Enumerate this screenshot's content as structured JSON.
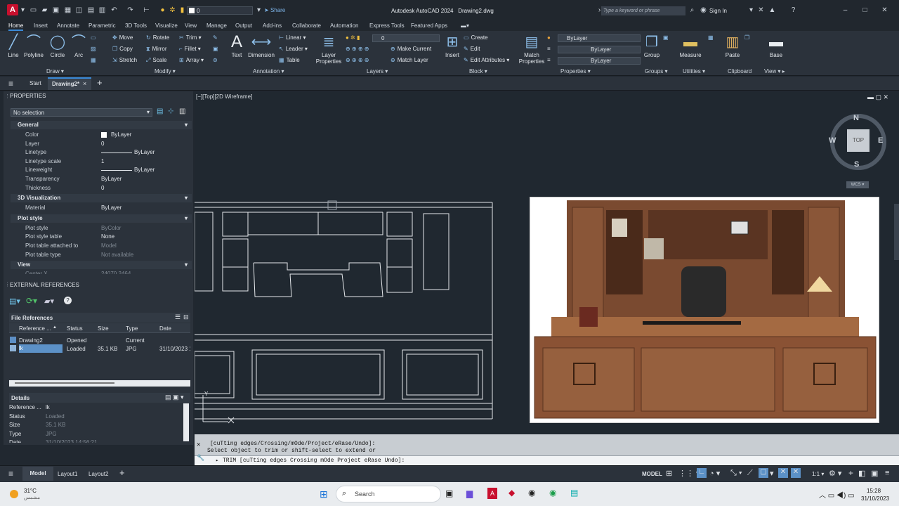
{
  "title": {
    "app_logo": "A",
    "workspace": "0",
    "share": "Share",
    "app_name": "Autodesk AutoCAD 2024",
    "document": "Drawing2.dwg",
    "search_placeholder": "Type a keyword or phrase",
    "sign_in": "Sign In"
  },
  "ribbon_tabs": [
    "Home",
    "Insert",
    "Annotate",
    "Parametric",
    "3D Tools",
    "Visualize",
    "View",
    "Manage",
    "Output",
    "Add-ins",
    "Collaborate",
    "Automation",
    "Express Tools",
    "Featured Apps"
  ],
  "ribbon": {
    "draw": {
      "line": "Line",
      "polyline": "Polyline",
      "circle": "Circle",
      "arc": "Arc",
      "label": "Draw"
    },
    "modify": {
      "move": "Move",
      "rotate": "Rotate",
      "trim": "Trim",
      "copy": "Copy",
      "mirror": "Mirror",
      "fillet": "Fillet",
      "stretch": "Stretch",
      "scale": "Scale",
      "array": "Array",
      "label": "Modify"
    },
    "annotation": {
      "text": "Text",
      "dimension": "Dimension",
      "linear": "Linear",
      "leader": "Leader",
      "table": "Table",
      "label": "Annotation"
    },
    "layers": {
      "layer_properties_1": "Layer",
      "layer_properties_2": "Properties",
      "layer_value": "0",
      "make_current": "Make Current",
      "match_layer": "Match Layer",
      "label": "Layers"
    },
    "block": {
      "insert": "Insert",
      "create": "Create",
      "edit": "Edit",
      "edit_attributes": "Edit Attributes",
      "label": "Block"
    },
    "properties": {
      "match_1": "Match",
      "match_2": "Properties",
      "color": "ByLayer",
      "linetype": "ByLayer",
      "lineweight": "ByLayer",
      "label": "Properties"
    },
    "groups": {
      "group": "Group",
      "label": "Groups"
    },
    "utilities": {
      "measure": "Measure",
      "label": "Utilities"
    },
    "clipboard": {
      "paste": "Paste",
      "label": "Clipboard"
    },
    "view": {
      "base": "Base",
      "label": "View"
    }
  },
  "doc_tabs": {
    "start": "Start",
    "drawing": "Drawing2*"
  },
  "properties_panel": {
    "title": "PROPERTIES",
    "selection": "No selection",
    "general": "General",
    "general_rows": [
      {
        "k": "Color",
        "v": "ByLayer"
      },
      {
        "k": "Layer",
        "v": "0"
      },
      {
        "k": "Linetype",
        "v": "ByLayer"
      },
      {
        "k": "Linetype scale",
        "v": "1"
      },
      {
        "k": "Lineweight",
        "v": "ByLayer"
      },
      {
        "k": "Transparency",
        "v": "ByLayer"
      },
      {
        "k": "Thickness",
        "v": "0"
      }
    ],
    "viz": "3D Visualization",
    "viz_rows": [
      {
        "k": "Material",
        "v": "ByLayer"
      }
    ],
    "plot": "Plot style",
    "plot_rows": [
      {
        "k": "Plot style",
        "v": "ByColor"
      },
      {
        "k": "Plot style table",
        "v": "None"
      },
      {
        "k": "Plot table attached to",
        "v": "Model"
      },
      {
        "k": "Plot table type",
        "v": "Not available"
      }
    ],
    "view": "View",
    "center_x": "Center X",
    "center_x_val": "24070.2464"
  },
  "xref_panel": {
    "title": "EXTERNAL REFERENCES",
    "file_refs": "File References",
    "columns": [
      "Reference ...",
      "Status",
      "Size",
      "Type",
      "Date"
    ],
    "rows": [
      {
        "name": "Drawing2",
        "status": "Opened",
        "size": "",
        "type": "Current",
        "date": ""
      },
      {
        "name": "lk",
        "status": "Loaded",
        "size": "35.1 KB",
        "type": "JPG",
        "date": "31/10/2023 1..."
      }
    ],
    "details": "Details",
    "detail_rows": [
      {
        "k": "Reference ...",
        "v": "lk"
      },
      {
        "k": "Status",
        "v": "Loaded"
      },
      {
        "k": "Size",
        "v": "35.1 KB"
      },
      {
        "k": "Type",
        "v": "JPG"
      },
      {
        "k": "Date",
        "v": "31/10/2023 14:56:21"
      }
    ]
  },
  "viewport": {
    "label": "[−][Top][2D Wireframe]",
    "compass": {
      "n": "N",
      "s": "S",
      "e": "E",
      "w": "W",
      "top": "TOP",
      "wcs": "WCS"
    },
    "ucs_y": "Y"
  },
  "command": {
    "line1": "[cuTting edges/Crossing/mOde/Project/eRase/Undo]:",
    "line2": "Select object to trim or shift-select to extend or",
    "prompt": "TRIM",
    "options": "[cuTting edges Crossing mOde Project eRase Undo]:"
  },
  "status_bar": {
    "model_tab": "Model",
    "layout1": "Layout1",
    "layout2": "Layout2",
    "model_mode": "MODEL",
    "scale": "1:1"
  },
  "taskbar": {
    "temp": "31°C",
    "weather": "مشمس",
    "search": "Search",
    "time": "15:28",
    "date": "31/10/2023"
  },
  "colors": {
    "accent": "#3a8ad8",
    "brand": "#c8102e",
    "viewport_bg": "#202830",
    "ribbon_bg": "#2b323b"
  }
}
